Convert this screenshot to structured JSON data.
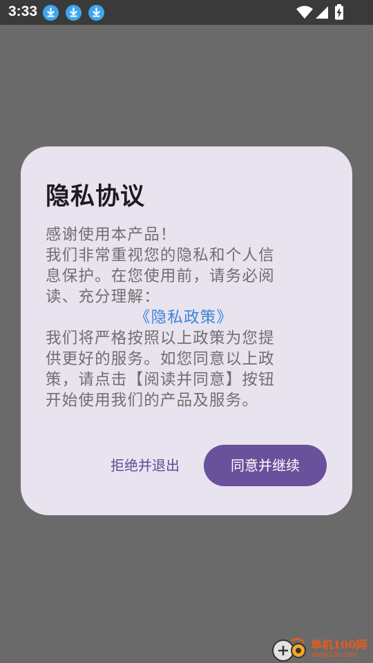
{
  "status_bar": {
    "time": "3:33",
    "notification_icons": [
      "download-icon",
      "download-icon",
      "download-icon"
    ],
    "system_icons": [
      "wifi-icon",
      "signal-icon",
      "battery-charging-icon"
    ]
  },
  "dialog": {
    "title": "隐私协议",
    "body_lines": [
      "感谢使用本产品！",
      "我们非常重视您的隐私和个人信",
      "息保护。在您使用前，请务必阅",
      "读、充分理解："
    ],
    "policy_link": "《隐私政策》",
    "body_lines_after": [
      "我们将严格按照以上政策为您提",
      "供更好的服务。如您同意以上政",
      "策，请点击【阅读并同意】按钮",
      "开始使用我们的产品及服务。"
    ],
    "reject_label": "拒绝并退出",
    "agree_label": "同意并继续"
  },
  "watermark": {
    "name": "单机100网",
    "url": "danji100.com"
  },
  "colors": {
    "scrim": "#6a6a6a",
    "status_bar": "#3a3a3a",
    "dialog_bg": "#e8e3ee",
    "primary": "#6a519b",
    "link": "#3c86d8",
    "download_badge": "#3ea6f0"
  }
}
